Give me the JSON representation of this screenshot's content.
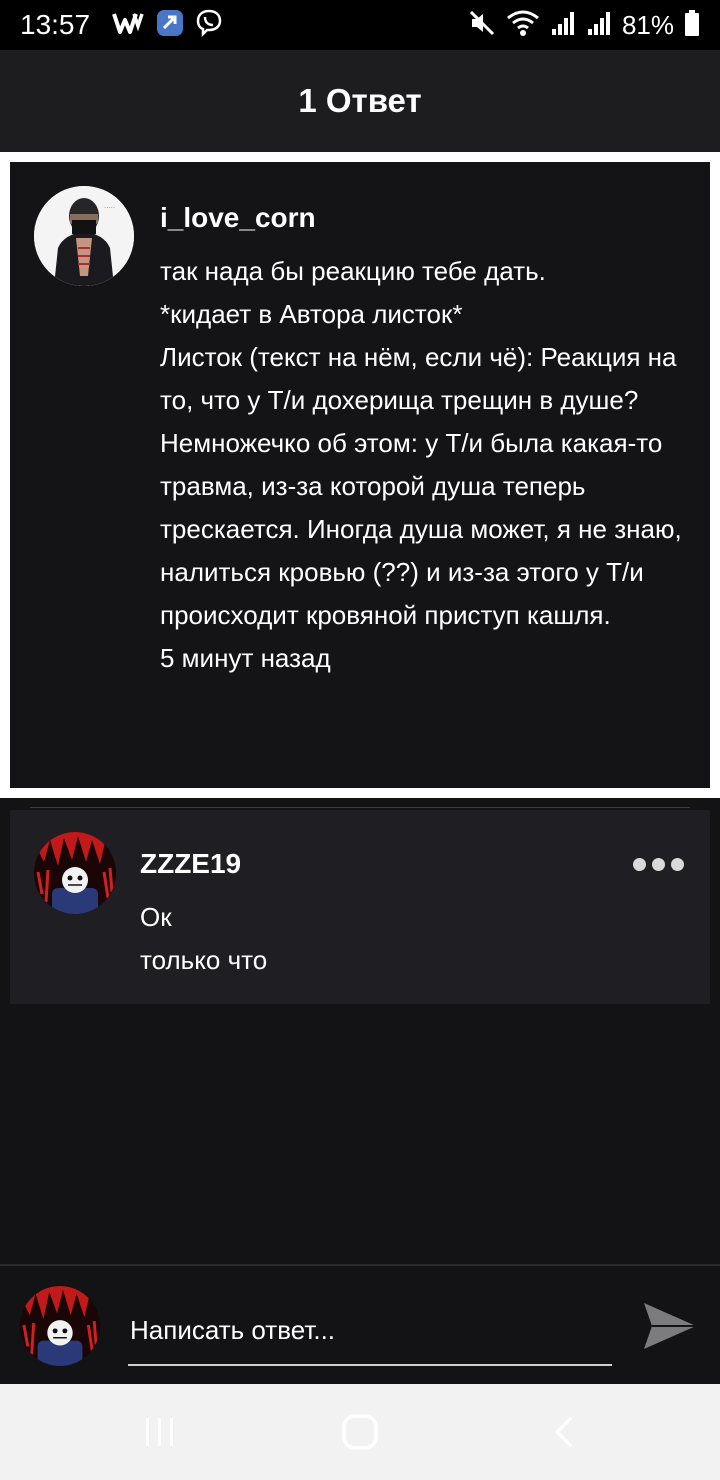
{
  "status_bar": {
    "time": "13:57",
    "battery_percent": "81%",
    "left_icons": [
      "wattpad-icon",
      "vk-icon",
      "viber-icon"
    ],
    "right_icons": [
      "mute-icon",
      "wifi-icon",
      "signal-icon",
      "signal-icon-2",
      "battery-icon"
    ]
  },
  "header": {
    "title": "1 Ответ"
  },
  "original_comment": {
    "author": "i_love_corn",
    "lines": [
      "так нада бы реакцию тебе дать.",
      "*кидает в Автора листок*",
      "Листок (текст на нём, если чё): Реакция на то, что у Т/и дохерища трещин в душе?",
      "Немножечко об этом: у Т/и была какая-то травма, из-за которой душа теперь трескается. Иногда душа может, я не знаю, налиться кровью (??) и из-за этого у Т/и происходит кровяной приступ кашля."
    ],
    "time": "5 минут назад"
  },
  "reply": {
    "author": "ZZZE19",
    "text": "Ок",
    "time": "только что"
  },
  "reply_bar": {
    "placeholder": "Написать ответ..."
  },
  "colors": {
    "background": "#131215",
    "header": "#1d1c1f",
    "card": "#141316",
    "reply_card": "#1f1e22",
    "nav_bar": "#f2f2f2"
  }
}
